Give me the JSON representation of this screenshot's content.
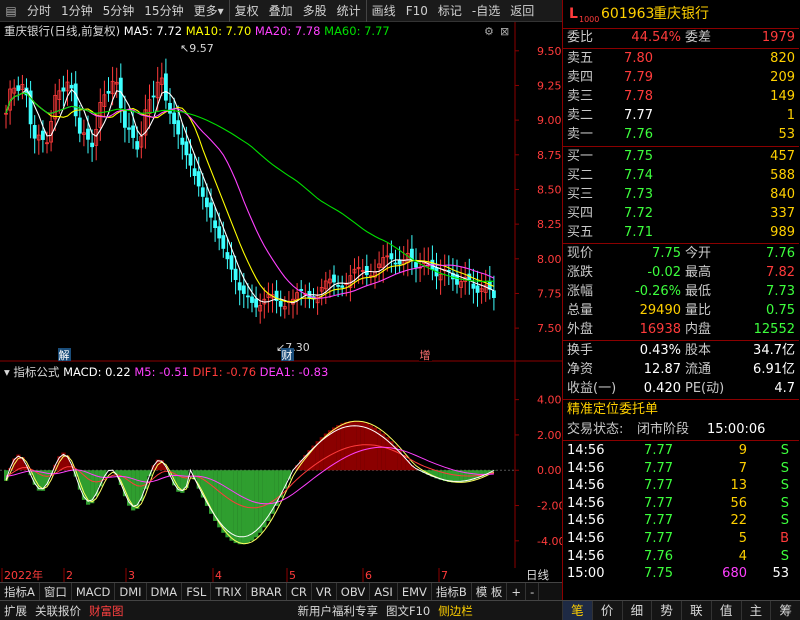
{
  "toolbar": {
    "items": [
      "分时",
      "1分钟",
      "5分钟",
      "15分钟",
      "更多",
      "复权",
      "叠加",
      "多股",
      "统计",
      "画线",
      "F10",
      "标记",
      "-自选",
      "返回"
    ]
  },
  "main_chart": {
    "stock_label": "重庆银行(日线,前复权)",
    "ma5": "MA5: 7.72",
    "ma10": "MA10: 7.70",
    "ma20": "MA20: 7.78",
    "ma60": "MA60: 7.77",
    "high_label": "9.57",
    "low_label": "7.30",
    "markers": [
      "解",
      "财",
      "增"
    ],
    "price_ticks": [
      "9.50",
      "9.25",
      "9.00",
      "8.75",
      "8.50",
      "8.25",
      "8.00",
      "7.75",
      "7.50"
    ],
    "colors": {
      "ma5": "#ffffff",
      "ma10": "#ffff00",
      "ma20": "#ff40ff",
      "ma60": "#00e000",
      "up": "#ff3b3b",
      "down": "#3dffff"
    }
  },
  "macd_chart": {
    "label": "指标公式",
    "macd": "MACD: 0.22",
    "m5": "M5: -0.51",
    "dif": "DIF1: -0.76",
    "dea": "DEA1: -0.83",
    "ticks": [
      "4.00",
      "2.00",
      "0.00",
      "-2.00",
      "-4.00"
    ]
  },
  "date_axis": {
    "labels": [
      "2022年",
      "2",
      "3",
      "4",
      "5",
      "6",
      "7"
    ],
    "right_label": "日线"
  },
  "bottom_tabs": [
    "指标A",
    "窗口",
    "MACD",
    "DMI",
    "DMA",
    "FSL",
    "TRIX",
    "BRAR",
    "CR",
    "VR",
    "OBV",
    "ASI",
    "EMV",
    "指标B",
    "模 板",
    "+",
    "-"
  ],
  "status_bar": [
    "扩展",
    "关联报价",
    "财富图",
    "新用户福利专享",
    "图文F10",
    "侧边栏"
  ],
  "right_panel": {
    "logo": "L",
    "logo_sub": "1000",
    "code": "601963",
    "name": "重庆银行",
    "weibi_label": "委比",
    "weibi": "44.54%",
    "weicha_label": "委差",
    "weicha": "1979",
    "asks": [
      {
        "label": "卖五",
        "price": "7.80",
        "vol": "820",
        "pc": "red"
      },
      {
        "label": "卖四",
        "price": "7.79",
        "vol": "209",
        "pc": "red"
      },
      {
        "label": "卖三",
        "price": "7.78",
        "vol": "149",
        "pc": "red"
      },
      {
        "label": "卖二",
        "price": "7.77",
        "vol": "1",
        "pc": "white"
      },
      {
        "label": "卖一",
        "price": "7.76",
        "vol": "53",
        "pc": "green"
      }
    ],
    "bids": [
      {
        "label": "买一",
        "price": "7.75",
        "vol": "457",
        "pc": "green"
      },
      {
        "label": "买二",
        "price": "7.74",
        "vol": "588",
        "pc": "green"
      },
      {
        "label": "买三",
        "price": "7.73",
        "vol": "840",
        "pc": "green"
      },
      {
        "label": "买四",
        "price": "7.72",
        "vol": "337",
        "pc": "green"
      },
      {
        "label": "买五",
        "price": "7.71",
        "vol": "989",
        "pc": "green"
      }
    ],
    "stats": [
      {
        "l1": "现价",
        "v1": "7.75",
        "c1": "green",
        "l2": "今开",
        "v2": "7.76",
        "c2": "green"
      },
      {
        "l1": "涨跌",
        "v1": "-0.02",
        "c1": "green",
        "l2": "最高",
        "v2": "7.82",
        "c2": "red"
      },
      {
        "l1": "涨幅",
        "v1": "-0.26%",
        "c1": "green",
        "l2": "最低",
        "v2": "7.73",
        "c2": "green"
      },
      {
        "l1": "总量",
        "v1": "29490",
        "c1": "yellow",
        "l2": "量比",
        "v2": "0.75",
        "c2": "green"
      },
      {
        "l1": "外盘",
        "v1": "16938",
        "c1": "red",
        "l2": "内盘",
        "v2": "12552",
        "c2": "green"
      }
    ],
    "stats2": [
      {
        "l1": "换手",
        "v1": "0.43%",
        "l2": "股本",
        "v2": "34.7亿"
      },
      {
        "l1": "净资",
        "v1": "12.87",
        "l2": "流通",
        "v2": "6.91亿"
      },
      {
        "l1": "收益(一)",
        "v1": "0.420",
        "l2": "PE(动)",
        "v2": "4.7"
      }
    ],
    "precise_label": "精准定位委托单",
    "trade_status_label": "交易状态:",
    "trade_status": "闭市阶段",
    "trade_time": "15:00:06",
    "ticks": [
      {
        "t": "14:56",
        "p": "7.77",
        "v": "9",
        "s": "S",
        "sc": "green"
      },
      {
        "t": "14:56",
        "p": "7.77",
        "v": "7",
        "s": "S",
        "sc": "green"
      },
      {
        "t": "14:56",
        "p": "7.77",
        "v": "13",
        "s": "S",
        "sc": "green"
      },
      {
        "t": "14:56",
        "p": "7.77",
        "v": "56",
        "s": "S",
        "sc": "green"
      },
      {
        "t": "14:56",
        "p": "7.77",
        "v": "22",
        "s": "S",
        "sc": "green"
      },
      {
        "t": "14:56",
        "p": "7.77",
        "v": "5",
        "s": "B",
        "sc": "red"
      },
      {
        "t": "14:56",
        "p": "7.76",
        "v": "4",
        "s": "S",
        "sc": "green"
      },
      {
        "t": "15:00",
        "p": "7.75",
        "v": "680",
        "s": "53",
        "sc": "white"
      }
    ]
  },
  "bottom_nav": [
    "笔",
    "价",
    "细",
    "势",
    "联",
    "值",
    "主",
    "筹"
  ]
}
